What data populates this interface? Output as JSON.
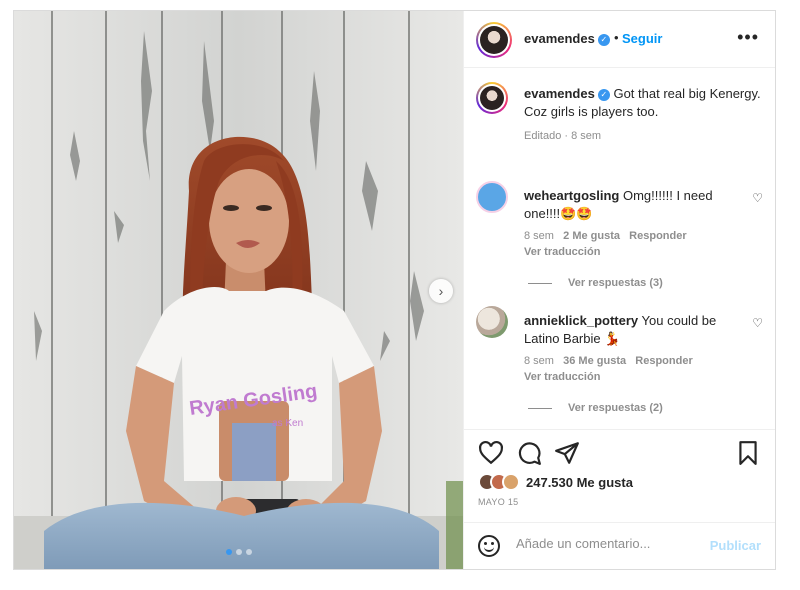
{
  "post": {
    "author": {
      "username": "evamendes",
      "verified": true,
      "follow_label": "Seguir",
      "separator": "•"
    },
    "caption": {
      "username": "evamendes",
      "lines": [
        "Got that real big Kenergy.",
        "Coz girls is players too."
      ],
      "meta": "Editado · 8 sem"
    },
    "comments": [
      {
        "username": "weheartgosling",
        "text": "Omg!!!!!! I need one!!!!🤩🤩",
        "age": "8 sem",
        "likes": "2 Me gusta",
        "reply_label": "Responder",
        "translate_label": "Ver traducción",
        "view_replies": "Ver respuestas (3)"
      },
      {
        "username": "annieklick_pottery",
        "text": "You could be Latino Barbie 💃",
        "age": "8 sem",
        "likes": "36 Me gusta",
        "reply_label": "Responder",
        "translate_label": "Ver traducción",
        "view_replies": "Ver respuestas (2)"
      }
    ],
    "icons": {
      "like": "heart-outline-icon",
      "comment": "speech-bubble-icon",
      "share": "paper-plane-icon",
      "save": "bookmark-icon",
      "more": "ellipsis-icon",
      "emoji": "emoji-smile-icon",
      "next": "chevron-right-icon"
    },
    "likes_count": "247.530 Me gusta",
    "date": "MAYO 15",
    "comment_placeholder": "Añade un comentario...",
    "publish_label": "Publicar",
    "carousel": {
      "total": 3,
      "current": 1
    },
    "shirt_text": {
      "line1": "Ryan Gosling",
      "line2": "as Ken"
    },
    "colors": {
      "accent": "#0095f6",
      "publish_disabled": "#b2dffc",
      "muted": "#8e8e8e"
    }
  }
}
